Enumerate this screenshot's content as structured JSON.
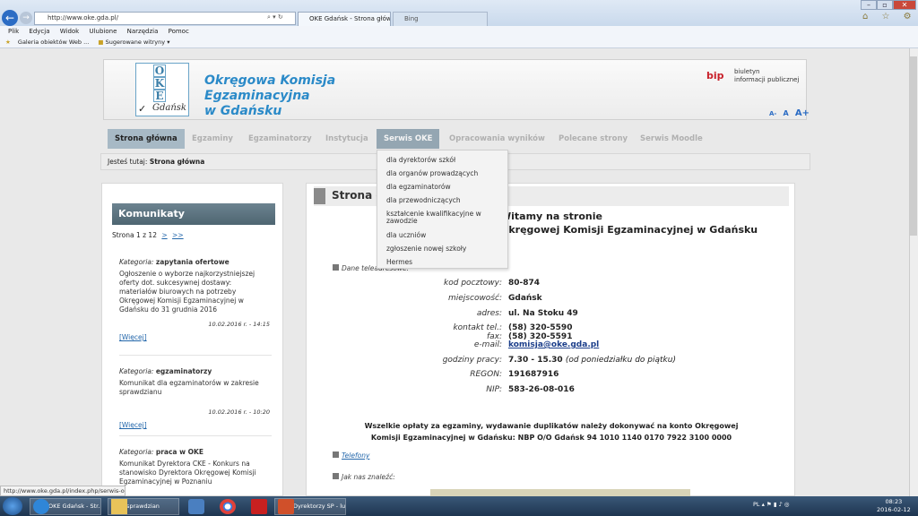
{
  "browser": {
    "address": "http://www.oke.gda.pl/",
    "tabs": [
      "OKE Gdańsk - Strona główna",
      "Bing"
    ],
    "menu": [
      "Plik",
      "Edycja",
      "Widok",
      "Ulubione",
      "Narzędzia",
      "Pomoc"
    ],
    "favorites": [
      "Galeria obiektów Web ...",
      "Sugerowane witryny"
    ],
    "status_url": "http://www.oke.gda.pl/index.php/serwis-oke"
  },
  "header": {
    "logo_letters": [
      "O",
      "K",
      "E"
    ],
    "logo_check": "✓",
    "logo_city": "Gdańsk",
    "title_line1": "Okręgowa Komisja Egzaminacyjna",
    "title_line2": "w Gdańsku",
    "bip_logo": "bip",
    "bip_line1": "biuletyn",
    "bip_line2": "informacji publicznej",
    "font_small": "A-",
    "font_normal": "A",
    "font_large": "A+"
  },
  "nav": {
    "items": [
      "Strona główna",
      "Egzaminy",
      "Egzaminatorzy",
      "Instytucja",
      "Serwis OKE",
      "Opracowania wyników",
      "Polecane strony",
      "Serwis Moodle"
    ]
  },
  "breadcrumb": {
    "label": "Jesteś tutaj:",
    "current": "Strona główna"
  },
  "dropdown": {
    "items": [
      "dla dyrektorów szkół",
      "dla organów prowadzących",
      "dla egzaminatorów",
      "dla przewodniczących",
      "kształcenie kwalifikacyjne w zawodzie",
      "dla uczniów",
      "zgłoszenie nowej szkoły",
      "Hermes"
    ]
  },
  "komunikaty": {
    "title": "Komunikaty",
    "pager": "Strona 1 z 12",
    "next": ">",
    "last": ">>",
    "category_label": "Kategoria:",
    "more_label": "[Więcej]",
    "items": [
      {
        "category": "zapytania ofertowe",
        "text": "Ogłoszenie o wyborze najkorzystniejszej oferty dot. sukcesywnej dostawy: materiałów biurowych na potrzeby Okręgowej Komisji  Egzaminacyjnej w Gdańsku do 31 grudnia 2016",
        "date": "10.02.2016 r. - 14:15"
      },
      {
        "category": "egzaminatorzy",
        "text": "Komunikat dla egzaminatorów w zakresie sprawdzianu",
        "date": "10.02.2016 r. - 10:20"
      },
      {
        "category": "praca w OKE",
        "text": "Komunikat Dyrektora CKE - Konkurs na stanowisko Dyrektora Okręgowej Komisji Egzaminacyjnej w Poznaniu",
        "date": ""
      }
    ]
  },
  "content": {
    "title": "Strona główna",
    "welcome_line1": "Witamy na stronie",
    "welcome_line2": "Okręgowej Komisji Egzaminacyjnej w Gdańsku",
    "section_address": "Dane teleadresowe:",
    "postal_label": "kod pocztowy:",
    "postal": "80-874",
    "city_label": "miejscowość:",
    "city": "Gdańsk",
    "addr_label": "adres:",
    "addr": "ul. Na Stoku 49",
    "tel_label": "kontakt tel.:",
    "tel": "(58) 320-5590",
    "fax_label": "fax:",
    "fax": "(58) 320-5591",
    "email_label": "e-mail:",
    "email": "komisja@oke.gda.pl",
    "hours_label": "godziny pracy:",
    "hours": "7.30 - 15.30",
    "hours_note": "(od poniedziałku do piątku)",
    "regon_label": "REGON:",
    "regon": "191687916",
    "nip_label": "NIP:",
    "nip": "583-26-08-016",
    "fees_line1": "Wszelkie opłaty za egzaminy, wydawanie duplikatów należy dokonywać na konto Okręgowej",
    "fees_line2": "Komisji Egzaminacyjnej w Gdańsku: NBP O/O Gdańsk 94 1010 1140 0170 7922 3100 0000",
    "phones_link": "Telefony",
    "find_us": "Jak nas znaleźć:"
  },
  "taskbar": {
    "items": [
      "OKE Gdańsk - Str...",
      "sprawdzian",
      "Dyrektorzy SP - lu..."
    ],
    "lang": "PL",
    "time": "08:23",
    "date": "2016-02-12"
  },
  "colors": {
    "accent": "#2b8ac8",
    "nav_active": "#a7b9c5",
    "panel_header": "#5a717d"
  }
}
